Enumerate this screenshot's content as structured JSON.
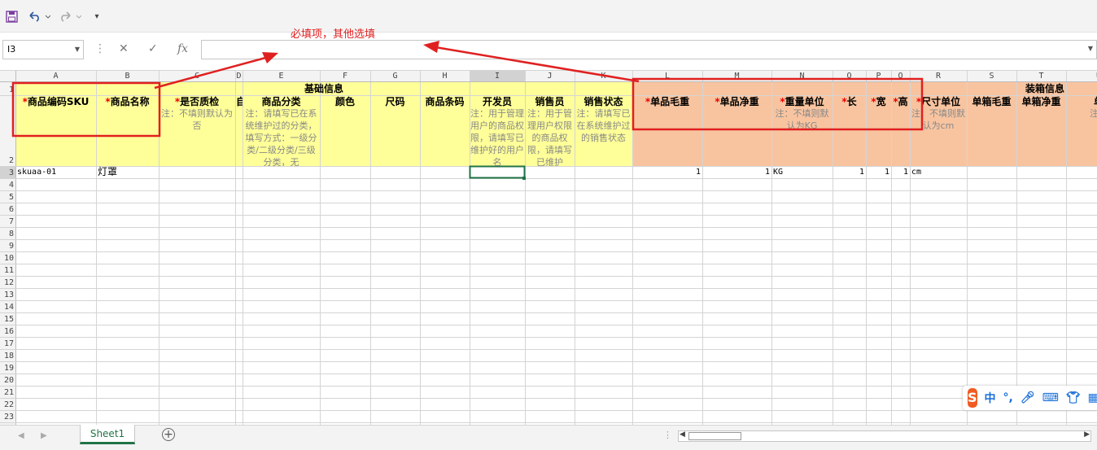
{
  "namebox": {
    "value": "I3"
  },
  "formula": {
    "fx_label": "fx",
    "value": ""
  },
  "columns": [
    "A",
    "B",
    "C",
    "D",
    "E",
    "F",
    "G",
    "H",
    "I",
    "J",
    "K",
    "L",
    "M",
    "N",
    "O",
    "P",
    "Q",
    "R",
    "S",
    "T",
    "U"
  ],
  "rows": [
    "1",
    "2",
    "3",
    "4",
    "5",
    "6",
    "7",
    "8",
    "9",
    "10",
    "11",
    "12",
    "13",
    "14",
    "15",
    "16",
    "17",
    "18",
    "19",
    "20",
    "21",
    "22",
    "23"
  ],
  "groups": {
    "basic": "基础信息",
    "box": "装箱信息"
  },
  "headers": [
    {
      "col": "A",
      "star": "*",
      "title": "商品编码SKU",
      "note": ""
    },
    {
      "col": "B",
      "star": "*",
      "title": "商品名称",
      "note": ""
    },
    {
      "col": "C",
      "star": "*",
      "title": "是否质检",
      "note": "注：不填则默认为否"
    },
    {
      "col": "D",
      "star": "",
      "title": "自",
      "note": ""
    },
    {
      "col": "E",
      "star": "",
      "title": "商品分类",
      "note": "注：请填写已在系统维护过的分类，填写方式：一级分类/二级分类/三级分类，无"
    },
    {
      "col": "F",
      "star": "",
      "title": "颜色",
      "note": ""
    },
    {
      "col": "G",
      "star": "",
      "title": "尺码",
      "note": ""
    },
    {
      "col": "H",
      "star": "",
      "title": "商品条码",
      "note": ""
    },
    {
      "col": "I",
      "star": "",
      "title": "开发员",
      "note": "注：用于管理用户的商品权限，请填写已维护好的用户名"
    },
    {
      "col": "J",
      "star": "",
      "title": "销售员",
      "note": "注：用于管理用户权限的商品权限，请填写已维护"
    },
    {
      "col": "K",
      "star": "",
      "title": "销售状态",
      "note": "注：请填写已在系统维护过的销售状态"
    },
    {
      "col": "L",
      "star": "*",
      "title": "单品毛重",
      "note": ""
    },
    {
      "col": "M",
      "star": "*",
      "title": "单品净重",
      "note": ""
    },
    {
      "col": "N",
      "star": "*",
      "title": "重量单位",
      "note": "注：不填则默认为KG"
    },
    {
      "col": "O",
      "star": "*",
      "title": "长",
      "note": ""
    },
    {
      "col": "P",
      "star": "*",
      "title": "宽",
      "note": ""
    },
    {
      "col": "Q",
      "star": "*",
      "title": "高",
      "note": ""
    },
    {
      "col": "R",
      "star": "*",
      "title": "尺寸单位",
      "note": "注：不填则默认为cm"
    },
    {
      "col": "S",
      "star": "",
      "title": "单箱毛重",
      "note": ""
    },
    {
      "col": "T",
      "star": "",
      "title": "单箱净重",
      "note": ""
    },
    {
      "col": "U",
      "star": "",
      "title": "单",
      "note": "注："
    }
  ],
  "row3": {
    "A": "skuaa-01",
    "B": "灯罩",
    "L": "1",
    "M": "1",
    "N": "KG",
    "O": "1",
    "P": "1",
    "Q": "1",
    "R": "cm"
  },
  "annotation": {
    "text": "必填项，其他选填",
    "color": "#e02020"
  },
  "sheets": [
    {
      "label": "Sheet1",
      "active": true
    }
  ],
  "ime": {
    "logo": "S",
    "mode": "中",
    "punct": "°,"
  },
  "colors": {
    "yellow": "#ffff99",
    "orange": "#f8c4a0",
    "grid": "#d4d4d4",
    "accent": "#217346",
    "red": "#e00000"
  }
}
